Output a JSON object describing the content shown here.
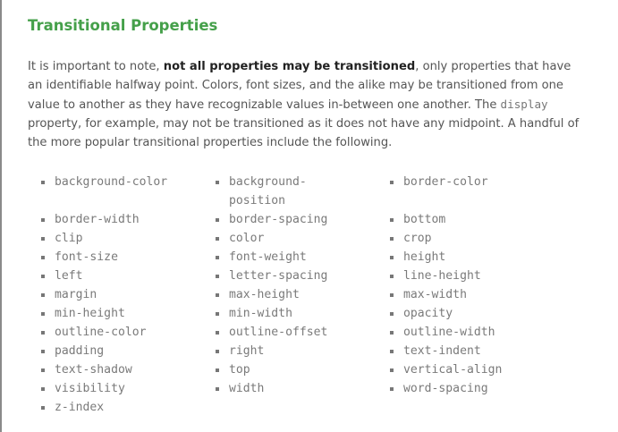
{
  "heading": "Transitional Properties",
  "intro": {
    "part1": "It is important to note, ",
    "bold": "not all properties may be transitioned",
    "part2": ", only properties that have an identifiable halfway point. Colors, font sizes, and the alike may be transitioned from one value to another as they have recognizable values in-between one another. The ",
    "code": "display",
    "part3": " property, for example, may not be transitioned as it does not have any midpoint. A handful of the more popular transitional properties include the following."
  },
  "columns": [
    [
      "background-color",
      "border-width",
      "clip",
      "font-size",
      "left",
      "margin",
      "min-height",
      "outline-color",
      "padding",
      "text-shadow",
      "visibility",
      "z-index"
    ],
    [
      "background-\nposition",
      "border-spacing",
      "color",
      "font-weight",
      "letter-spacing",
      "max-height",
      "min-width",
      "outline-offset",
      "right",
      "top",
      "width"
    ],
    [
      "border-color",
      "bottom",
      "crop",
      "height",
      "line-height",
      "max-width",
      "opacity",
      "outline-width",
      "text-indent",
      "vertical-align",
      "word-spacing"
    ]
  ]
}
